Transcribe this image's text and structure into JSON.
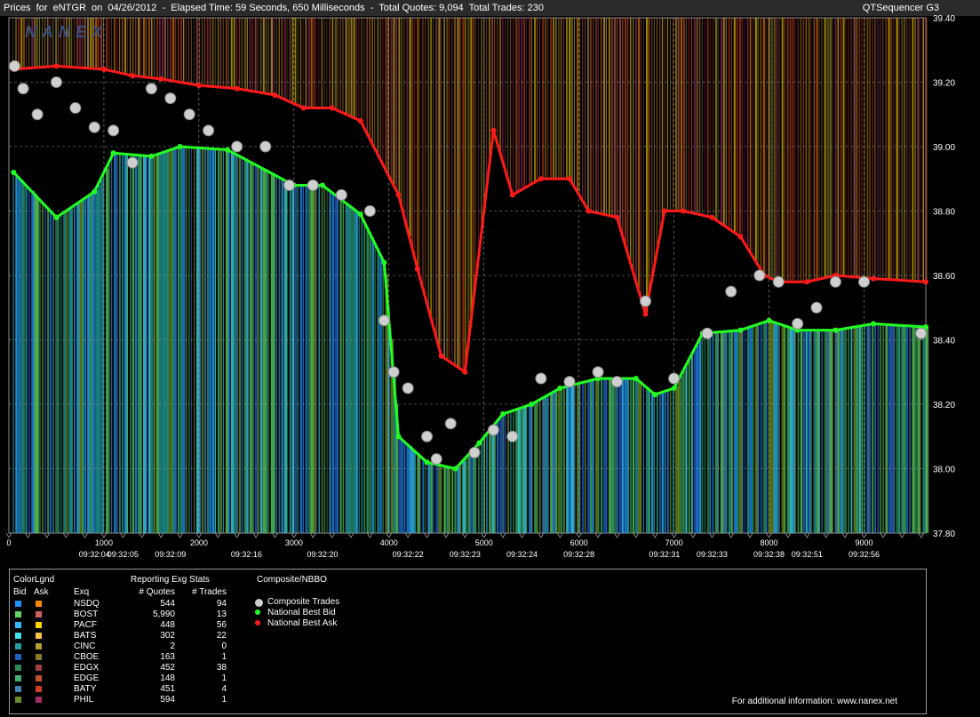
{
  "title": {
    "text": "Prices  for  eNTGR  on  04/26/2012  -  Elapsed Time: 59 Seconds, 650 Milliseconds  -  Total Quotes: 9,094  Total Trades: 230",
    "app_name": "QTSequencer G3"
  },
  "watermark": "NANEX",
  "chart_data": {
    "type": "line",
    "xlim": [
      0,
      9650
    ],
    "ylim": [
      37.8,
      39.4
    ],
    "x_ticks": [
      0,
      1000,
      2000,
      3000,
      4000,
      5000,
      6000,
      7000,
      8000,
      9000
    ],
    "y_ticks": [
      "39.40",
      "39.20",
      "39.00",
      "38.80",
      "38.60",
      "38.40",
      "38.20",
      "38.00",
      "37.80"
    ],
    "time_labels": [
      {
        "x": 900,
        "label": "09:32:04"
      },
      {
        "x": 1200,
        "label": "09:32:05"
      },
      {
        "x": 1700,
        "label": "09:32:09"
      },
      {
        "x": 2500,
        "label": "09:32:16"
      },
      {
        "x": 3300,
        "label": "09:32:20"
      },
      {
        "x": 4200,
        "label": "09:32:22"
      },
      {
        "x": 4800,
        "label": "09:32:23"
      },
      {
        "x": 5400,
        "label": "09:32:24"
      },
      {
        "x": 6000,
        "label": "09:32:28"
      },
      {
        "x": 6900,
        "label": "09:32:31"
      },
      {
        "x": 7400,
        "label": "09:32:33"
      },
      {
        "x": 8000,
        "label": "09:32:38"
      },
      {
        "x": 8400,
        "label": "09:32:51"
      },
      {
        "x": 9000,
        "label": "09:32:56"
      }
    ],
    "grid": true,
    "series": [
      {
        "name": "National Best Ask",
        "color": "#ff1a1a",
        "points": [
          [
            50,
            39.24
          ],
          [
            500,
            39.25
          ],
          [
            1000,
            39.24
          ],
          [
            1300,
            39.22
          ],
          [
            1600,
            39.21
          ],
          [
            2000,
            39.19
          ],
          [
            2400,
            39.18
          ],
          [
            2800,
            39.16
          ],
          [
            3100,
            39.12
          ],
          [
            3400,
            39.12
          ],
          [
            3700,
            39.08
          ],
          [
            4100,
            38.85
          ],
          [
            4300,
            38.62
          ],
          [
            4550,
            38.35
          ],
          [
            4800,
            38.3
          ],
          [
            5100,
            39.05
          ],
          [
            5300,
            38.85
          ],
          [
            5600,
            38.9
          ],
          [
            5900,
            38.9
          ],
          [
            6100,
            38.8
          ],
          [
            6400,
            38.78
          ],
          [
            6700,
            38.48
          ],
          [
            6900,
            38.8
          ],
          [
            7100,
            38.8
          ],
          [
            7400,
            38.78
          ],
          [
            7700,
            38.72
          ],
          [
            7950,
            38.6
          ],
          [
            8100,
            38.58
          ],
          [
            8400,
            38.58
          ],
          [
            8700,
            38.6
          ],
          [
            9100,
            38.59
          ],
          [
            9650,
            38.58
          ]
        ]
      },
      {
        "name": "National Best Bid",
        "color": "#22ff22",
        "points": [
          [
            50,
            38.92
          ],
          [
            500,
            38.78
          ],
          [
            900,
            38.86
          ],
          [
            1100,
            38.98
          ],
          [
            1500,
            38.97
          ],
          [
            1800,
            39.0
          ],
          [
            2300,
            38.99
          ],
          [
            3000,
            38.88
          ],
          [
            3300,
            38.88
          ],
          [
            3700,
            38.79
          ],
          [
            3950,
            38.64
          ],
          [
            4100,
            38.1
          ],
          [
            4400,
            38.02
          ],
          [
            4700,
            38.0
          ],
          [
            4950,
            38.08
          ],
          [
            5200,
            38.17
          ],
          [
            5500,
            38.2
          ],
          [
            5800,
            38.25
          ],
          [
            6200,
            38.28
          ],
          [
            6600,
            38.28
          ],
          [
            6800,
            38.23
          ],
          [
            7000,
            38.25
          ],
          [
            7300,
            38.42
          ],
          [
            7700,
            38.43
          ],
          [
            8000,
            38.46
          ],
          [
            8300,
            38.43
          ],
          [
            8700,
            38.43
          ],
          [
            9100,
            38.45
          ],
          [
            9650,
            38.44
          ]
        ]
      },
      {
        "name": "Composite Trades",
        "color": "#cfcfcf",
        "points": [
          [
            60,
            39.25
          ],
          [
            150,
            39.18
          ],
          [
            300,
            39.1
          ],
          [
            500,
            39.2
          ],
          [
            700,
            39.12
          ],
          [
            900,
            39.06
          ],
          [
            1100,
            39.05
          ],
          [
            1300,
            38.95
          ],
          [
            1500,
            39.18
          ],
          [
            1700,
            39.15
          ],
          [
            1900,
            39.1
          ],
          [
            2100,
            39.05
          ],
          [
            2400,
            39.0
          ],
          [
            2700,
            39.0
          ],
          [
            2950,
            38.88
          ],
          [
            3200,
            38.88
          ],
          [
            3500,
            38.85
          ],
          [
            3800,
            38.8
          ],
          [
            3950,
            38.46
          ],
          [
            4050,
            38.3
          ],
          [
            4200,
            38.25
          ],
          [
            4400,
            38.1
          ],
          [
            4500,
            38.03
          ],
          [
            4650,
            38.14
          ],
          [
            4900,
            38.05
          ],
          [
            5100,
            38.12
          ],
          [
            5300,
            38.1
          ],
          [
            5600,
            38.28
          ],
          [
            5900,
            38.27
          ],
          [
            6200,
            38.3
          ],
          [
            6400,
            38.27
          ],
          [
            6700,
            38.52
          ],
          [
            7000,
            38.28
          ],
          [
            7350,
            38.42
          ],
          [
            7600,
            38.55
          ],
          [
            7900,
            38.6
          ],
          [
            8100,
            38.58
          ],
          [
            8300,
            38.45
          ],
          [
            8500,
            38.5
          ],
          [
            8700,
            38.58
          ],
          [
            9000,
            38.58
          ],
          [
            9600,
            38.42
          ]
        ]
      }
    ],
    "legend_series": [
      "Composite Trades",
      "National Best Bid",
      "National Best Ask"
    ]
  },
  "legend": {
    "colorlgnd_label": "ColorLgnd",
    "bid_label": "Bid",
    "ask_label": "Ask",
    "exq_label": "Exq",
    "stats_title": "Reporting Exg Stats",
    "quotes_label": "# Quotes",
    "trades_label": "# Trades",
    "composite_title": "Composite/NBBO",
    "rows": [
      {
        "exch": "NSDQ",
        "quotes": "544",
        "trades": "94",
        "bid_color": "#1e90ff",
        "ask_color": "#ff8c00"
      },
      {
        "exch": "BOST",
        "quotes": "5,990",
        "trades": "13",
        "bid_color": "#5fd35f",
        "ask_color": "#d06060"
      },
      {
        "exch": "PACF",
        "quotes": "448",
        "trades": "56",
        "bid_color": "#2fb8ff",
        "ask_color": "#ffd700"
      },
      {
        "exch": "BATS",
        "quotes": "302",
        "trades": "22",
        "bid_color": "#40e0f0",
        "ask_color": "#ffc04d"
      },
      {
        "exch": "CINC",
        "quotes": "2",
        "trades": "0",
        "bid_color": "#209e9e",
        "ask_color": "#b0a030"
      },
      {
        "exch": "CBOE",
        "quotes": "163",
        "trades": "1",
        "bid_color": "#2060c0",
        "ask_color": "#8a7a20"
      },
      {
        "exch": "EDGX",
        "quotes": "452",
        "trades": "38",
        "bid_color": "#2e8b57",
        "ask_color": "#a04040"
      },
      {
        "exch": "EDGE",
        "quotes": "148",
        "trades": "1",
        "bid_color": "#3cb371",
        "ask_color": "#c05030"
      },
      {
        "exch": "BATY",
        "quotes": "451",
        "trades": "4",
        "bid_color": "#4682b4",
        "ask_color": "#d04020"
      },
      {
        "exch": "PHIL",
        "quotes": "594",
        "trades": "1",
        "bid_color": "#6b8e23",
        "ask_color": "#a0306a"
      }
    ],
    "nbbo_items": [
      {
        "label": "Composite Trades",
        "color": "#cfcfcf"
      },
      {
        "label": "National Best Bid",
        "color": "#22ff22"
      },
      {
        "label": "National Best Ask",
        "color": "#ff1a1a"
      }
    ],
    "footer": "For additional information: www.nanex.net"
  }
}
